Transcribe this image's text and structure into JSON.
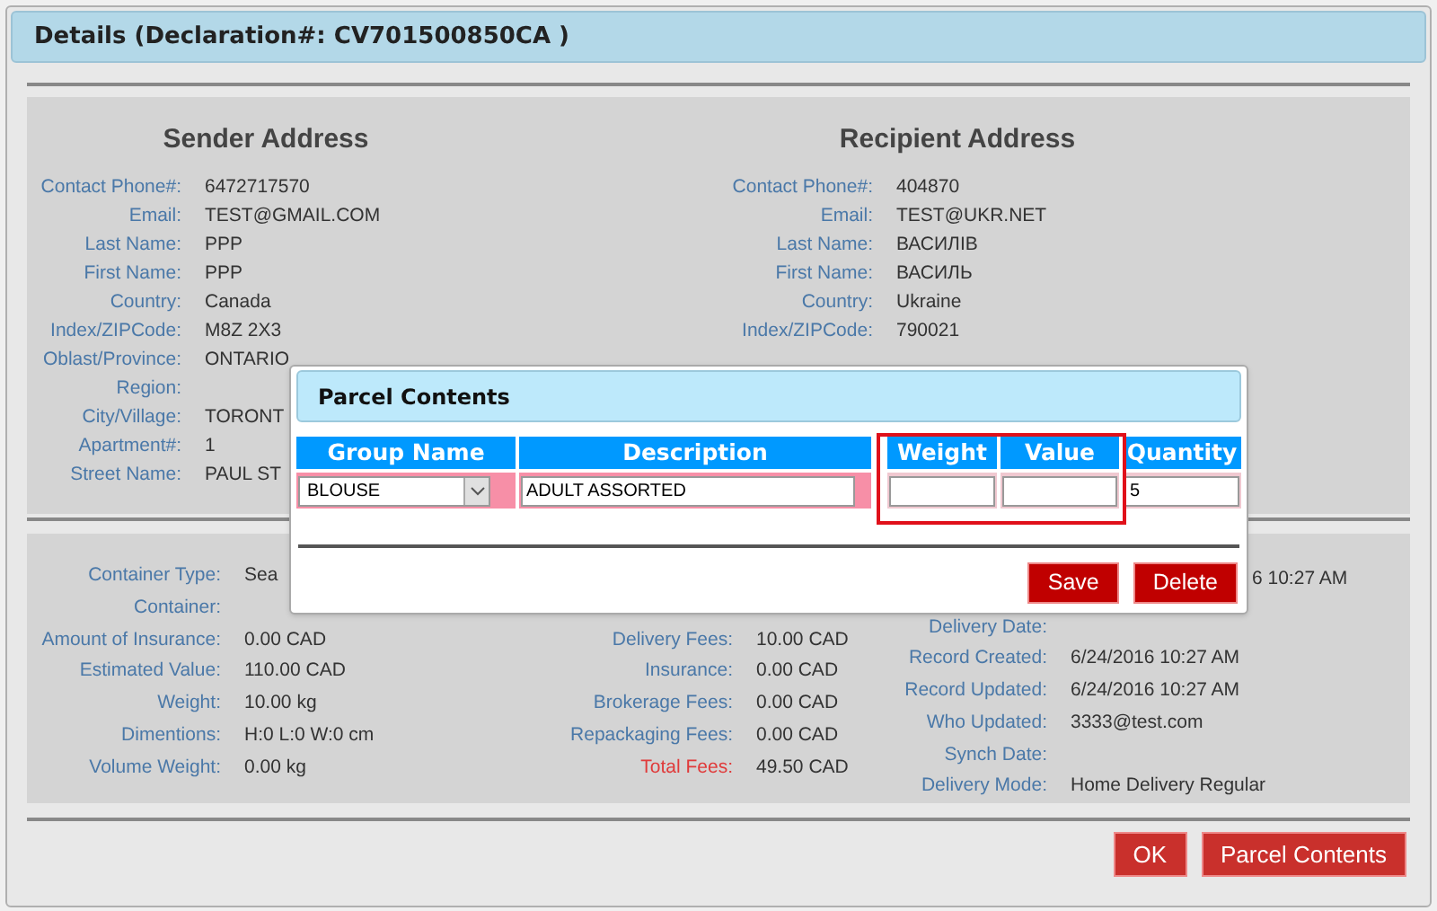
{
  "dialog": {
    "title": "Details (Declaration#: CV701500850CA )"
  },
  "sender": {
    "heading": "Sender Address",
    "fields": [
      {
        "label": "Contact Phone#:",
        "value": "6472717570"
      },
      {
        "label": "Email:",
        "value": "TEST@GMAIL.COM"
      },
      {
        "label": "Last Name:",
        "value": "PPP"
      },
      {
        "label": "First Name:",
        "value": "PPP"
      },
      {
        "label": "Country:",
        "value": "Canada"
      },
      {
        "label": "Index/ZIPCode:",
        "value": "M8Z 2X3"
      },
      {
        "label": "Oblast/Province:",
        "value": "ONTARIO"
      },
      {
        "label": "Region:"
      },
      {
        "label": "City/Village:",
        "value": "TORONT"
      },
      {
        "label": "Apartment#:",
        "value": "1"
      },
      {
        "label": "Street Name:",
        "value": "PAUL ST"
      }
    ]
  },
  "recipient": {
    "heading": "Recipient Address",
    "fields": [
      {
        "label": "Contact Phone#:",
        "value": "404870"
      },
      {
        "label": "Email:",
        "value": "TEST@UKR.NET"
      },
      {
        "label": "Last Name:",
        "value": "ВАСИЛІВ"
      },
      {
        "label": "First Name:",
        "value": "ВАСИЛЬ"
      },
      {
        "label": "Country:",
        "value": "Ukraine"
      },
      {
        "label": "Index/ZIPCode:",
        "value": "790021"
      }
    ]
  },
  "details": {
    "columns": [
      [
        {
          "label": "Container Type:",
          "value": "Sea"
        },
        {
          "label": "Container:"
        },
        {
          "label": "Amount of Insurance:",
          "value": "0.00 CAD"
        },
        {
          "label": "Estimated Value:",
          "value": "110.00 CAD"
        },
        {
          "label": "Weight:",
          "value": "10.00 kg"
        },
        {
          "label": "Dimentions:",
          "value": "H:0 L:0 W:0 cm"
        },
        {
          "label": "Volume Weight:",
          "value": "0.00 kg"
        }
      ],
      [
        {
          "label": "Delivery Fees:",
          "value": "10.00 CAD"
        },
        {
          "label": "Insurance:",
          "value": "0.00 CAD"
        },
        {
          "label": "Brokerage Fees:",
          "value": "0.00 CAD"
        },
        {
          "label": "Repackaging Fees:",
          "value": "0.00 CAD"
        },
        {
          "label": "Total Fees:",
          "value": "49.50 CAD",
          "kind": "total"
        }
      ],
      [
        {
          "value": "6 10:27 AM",
          "kind": "fragment"
        },
        {
          "label": "Delivery Date:"
        },
        {
          "label": "Record Created:",
          "value": "6/24/2016 10:27 AM"
        },
        {
          "label": "Record Updated:",
          "value": "6/24/2016 10:27 AM"
        },
        {
          "label": "Who Updated:",
          "value": "3333@test.com"
        },
        {
          "label": "Synch Date:"
        },
        {
          "label": "Delivery Mode:",
          "value": "Home Delivery Regular"
        }
      ]
    ]
  },
  "buttons": [
    "OK",
    "Parcel Contents"
  ],
  "parcel_dialog": {
    "title": "Parcel Contents",
    "columns": [
      "Group Name",
      "Description",
      "Weight",
      "Value",
      "Quantity"
    ],
    "row": {
      "group_name": "BLOUSE",
      "description": "ADULT ASSORTED",
      "quantity": "5"
    },
    "buttons": [
      "Save",
      "Delete"
    ]
  }
}
